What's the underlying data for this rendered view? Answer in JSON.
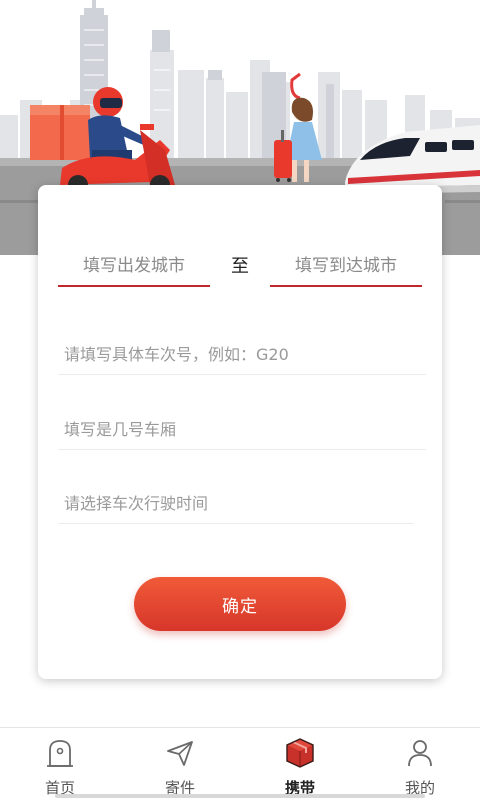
{
  "hero": {
    "illustration": "city-skyline-courier-traveler-train"
  },
  "form": {
    "from_placeholder": "填写出发城市",
    "to_separator": "至",
    "to_placeholder": "填写到达城市",
    "train_placeholder": "请填写具体车次号，例如：G20",
    "car_placeholder": "填写是几号车厢",
    "time_placeholder": "请选择车次行驶时间",
    "confirm_label": "确定"
  },
  "tabbar": {
    "items": [
      {
        "label": "首页",
        "icon": "home-icon",
        "active": false
      },
      {
        "label": "寄件",
        "icon": "paper-plane-icon",
        "active": false
      },
      {
        "label": "携带",
        "icon": "box-icon",
        "active": true
      },
      {
        "label": "我的",
        "icon": "user-icon",
        "active": false
      }
    ]
  },
  "colors": {
    "accent": "#d7362a",
    "underline": "#c0282c",
    "active_icon": "#c8302a"
  }
}
